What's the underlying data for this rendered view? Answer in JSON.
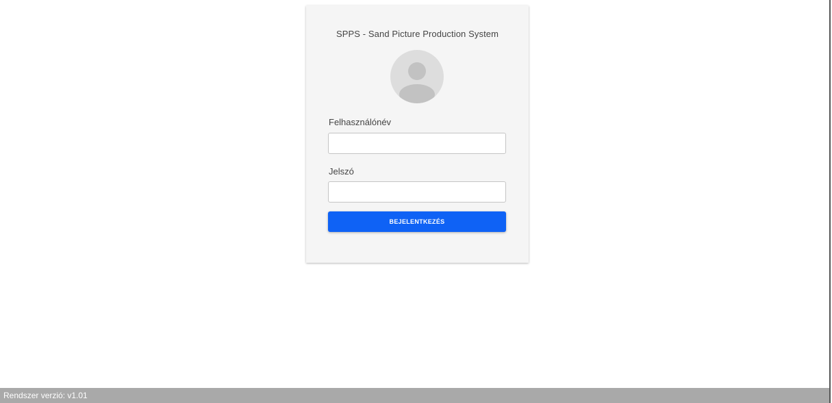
{
  "login": {
    "title": "SPPS - Sand Picture Production System",
    "avatar_icon": "user-avatar-icon",
    "username_label": "Felhasználónév",
    "username_value": "",
    "password_label": "Jelszó",
    "password_value": "",
    "submit_label": "BEJELENTKEZÉS"
  },
  "footer": {
    "version_text": "Rendszer verzió: v1.01"
  },
  "colors": {
    "card_background": "#f5f5f5",
    "primary_button": "#0f62f5",
    "footer_background": "#a9a9a9",
    "avatar_background": "#dddddd",
    "avatar_figure": "#c2c2c2"
  }
}
